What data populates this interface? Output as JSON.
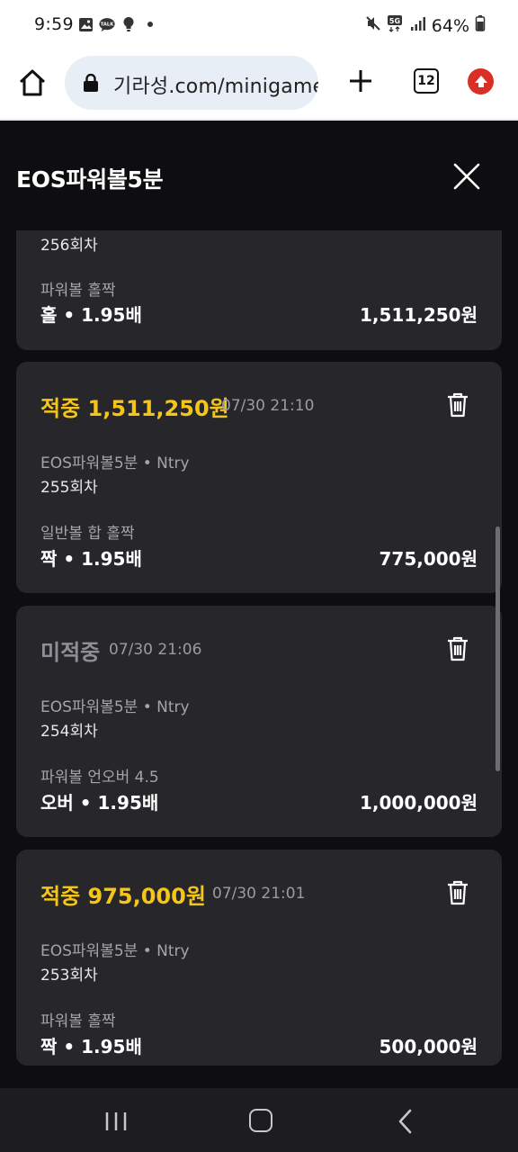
{
  "status_bar": {
    "time": "9:59",
    "network": "5G",
    "battery": "64%",
    "left_icons": [
      "gallery-icon",
      "kakaotalk-icon",
      "bulb-icon",
      "dot-icon"
    ],
    "kakao_label": "TALK"
  },
  "browser": {
    "url": "기라성.com/minigame",
    "tab_count": "12"
  },
  "header": {
    "title": "EOS파워볼5분"
  },
  "bets": [
    {
      "result": "",
      "time": "",
      "game": "",
      "round": "256회차",
      "market": "파워볼 홀짝",
      "pick": "홀 • 1.95배",
      "amount": "1,511,250원"
    },
    {
      "result": "적중 1,511,250원",
      "status": "win",
      "time": "07/30 21:10",
      "game": "EOS파워볼5분 • Ntry",
      "round": "255회차",
      "market": "일반볼 합 홀짝",
      "pick": "짝 • 1.95배",
      "amount": "775,000원"
    },
    {
      "result": "미적중",
      "status": "lose",
      "time": "07/30 21:06",
      "game": "EOS파워볼5분 • Ntry",
      "round": "254회차",
      "market": "파워볼 언오버 4.5",
      "pick": "오버 • 1.95배",
      "amount": "1,000,000원"
    },
    {
      "result": "적중 975,000원",
      "status": "win",
      "time": "07/30 21:01",
      "game": "EOS파워볼5분 • Ntry",
      "round": "253회차",
      "market": "파워볼 홀짝",
      "pick": "짝 • 1.95배",
      "amount": "500,000원"
    }
  ],
  "colors": {
    "win": "#f5c518",
    "lose": "#8f8f95",
    "card": "#27272b",
    "background": "#0e0e10"
  }
}
